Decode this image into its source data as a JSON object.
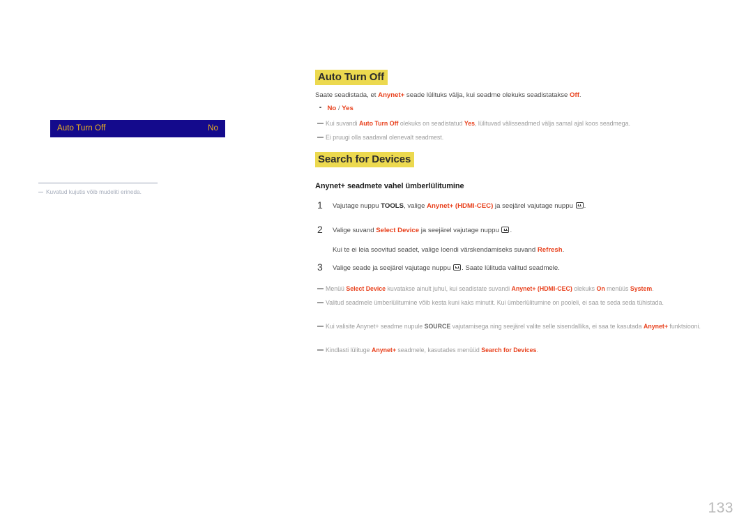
{
  "page": {
    "number": "133"
  },
  "figure": {
    "osd_bar": {
      "label": "Auto Turn Off",
      "value": "No",
      "bg_color": "#140a8c",
      "text_color": "#f0b41e"
    },
    "caption": "Kuvatud kujutis võib mudeliti erineda."
  },
  "sections": [
    {
      "heading": "Auto Turn Off",
      "heading_highlight_color": "#ecd94f",
      "intro": {
        "before": "Saate seadistada, et ",
        "term1": "Anynet+",
        "middle": " seade lülituks välja, kui seadme olekuks seadistatakse ",
        "term2": "Off",
        "after": "."
      },
      "options_bullet": {
        "option1": "No",
        "separator": " / ",
        "option2": "Yes"
      },
      "notes": [
        {
          "p1": "Kui suvandi ",
          "b1": "Auto Turn Off",
          "p2": " olekuks on seadistatud ",
          "b2": "Yes",
          "p3": ", lülituvad välisseadmed välja samal ajal koos seadmega."
        },
        {
          "p1": "Ei pruugi olla saadaval olenevalt seadmest."
        }
      ]
    },
    {
      "heading": "Search for Devices",
      "heading_highlight_color": "#ecd94f",
      "sub_heading": "Anynet+ seadmete vahel ümberlülitumine",
      "steps": [
        {
          "num": "1",
          "p1": "Vajutage nuppu ",
          "b1": "TOOLS",
          "p2": ", valige ",
          "b2": "Anynet+ (HDMI-CEC)",
          "p3": " ja seejärel vajutage nuppu ",
          "icon": "enter-key-icon",
          "p4": "."
        },
        {
          "num": "2",
          "p1": "Valige suvand ",
          "b1": "Select Device",
          "p2": " ja seejärel vajutage nuppu ",
          "icon": "enter-key-icon",
          "p3": "."
        },
        {
          "num": "3",
          "p1": "Valige seade ja seejärel vajutage nuppu ",
          "icon": "enter-key-icon",
          "p2": ". Saate lülituda valitud seadmele."
        }
      ],
      "sub_line": {
        "p1": "Kui te ei leia soovitud seadet, valige loendi värskendamiseks suvand ",
        "b1": "Refresh",
        "p2": "."
      },
      "notes": [
        {
          "p1": "Menüü ",
          "b1": "Select Device",
          "p2": " kuvatakse ainult juhul, kui seadistate suvandi ",
          "b2": "Anynet+ (HDMI-CEC)",
          "p3": " olekuks ",
          "b3": "On",
          "p4": " menüüs ",
          "b4": "System",
          "p5": "."
        },
        {
          "p1": "Valitud seadmele ümberlülitumine võib kesta kuni kaks minutit. Kui ümberlülitumine on pooleli, ei saa te seda seda tühistada."
        },
        {
          "p1": "Kui valisite Anynet+ seadme nupule ",
          "b1": "SOURCE",
          "p2": " vajutamisega ning seejärel valite selle sisendallika, ei saa te kasutada ",
          "b2": "Anynet+",
          "p3": " funktsiooni."
        },
        {
          "p1": "Kindlasti lülituge ",
          "b1": "Anynet+",
          "p2": " seadmele, kasutades menüüd ",
          "b2": "Search for Devices",
          "p3": "."
        }
      ]
    }
  ]
}
